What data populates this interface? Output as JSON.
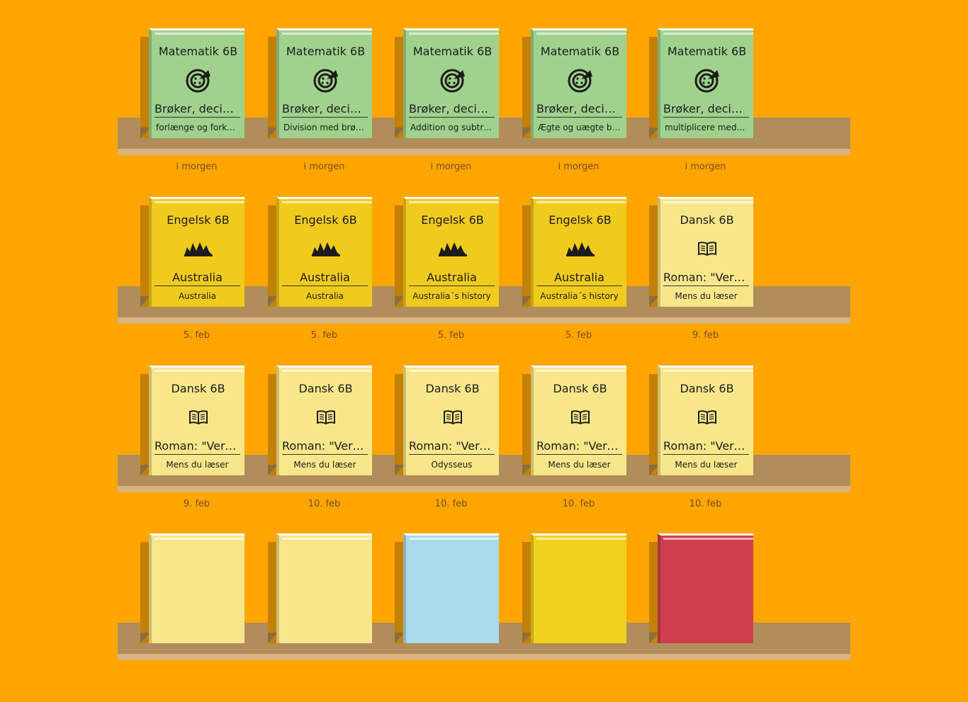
{
  "rows": [
    {
      "books": [
        {
          "color": "green",
          "subject": "Matematik 6B",
          "icon": "pie-chart-icon",
          "title": "Brøker, decimaltal",
          "lesson": "forlænge og forkorte",
          "date": "i morgen"
        },
        {
          "color": "green",
          "subject": "Matematik 6B",
          "icon": "pie-chart-icon",
          "title": "Brøker, decimaltal",
          "lesson": "Division med brøker",
          "date": "i morgen"
        },
        {
          "color": "green",
          "subject": "Matematik 6B",
          "icon": "pie-chart-icon",
          "title": "Brøker, decimaltal",
          "lesson": "Addition og subtraktion",
          "date": "i morgen"
        },
        {
          "color": "green",
          "subject": "Matematik 6B",
          "icon": "pie-chart-icon",
          "title": "Brøker, decimaltal",
          "lesson": "Ægte og uægte brøk",
          "date": "i morgen"
        },
        {
          "color": "green",
          "subject": "Matematik 6B",
          "icon": "pie-chart-icon",
          "title": "Brøker, decimaltal",
          "lesson": "multiplicere med brøker",
          "date": "i morgen"
        }
      ]
    },
    {
      "books": [
        {
          "color": "yellow",
          "subject": "Engelsk 6B",
          "icon": "opera-house-icon",
          "title": "Australia",
          "lesson": "Australia",
          "date": "5. feb"
        },
        {
          "color": "yellow",
          "subject": "Engelsk 6B",
          "icon": "opera-house-icon",
          "title": "Australia",
          "lesson": "Australia",
          "date": "5. feb"
        },
        {
          "color": "yellow",
          "subject": "Engelsk 6B",
          "icon": "opera-house-icon",
          "title": "Australia",
          "lesson": "Australia´s history",
          "date": "5. feb"
        },
        {
          "color": "yellow",
          "subject": "Engelsk 6B",
          "icon": "opera-house-icon",
          "title": "Australia",
          "lesson": "Australia´s history",
          "date": "5. feb"
        },
        {
          "color": "paleyellow",
          "subject": "Dansk 6B",
          "icon": "open-book-icon",
          "title": "Roman: \"Verdens\"",
          "lesson": "Mens du læser",
          "date": "9. feb"
        }
      ]
    },
    {
      "books": [
        {
          "color": "paleyellow",
          "subject": "Dansk 6B",
          "icon": "open-book-icon",
          "title": "Roman: \"Verdens\"",
          "lesson": "Mens du læser",
          "date": "9. feb"
        },
        {
          "color": "paleyellow",
          "subject": "Dansk 6B",
          "icon": "open-book-icon",
          "title": "Roman: \"Verdens\"",
          "lesson": "Mens du læser",
          "date": "10. feb"
        },
        {
          "color": "paleyellow",
          "subject": "Dansk 6B",
          "icon": "open-book-icon",
          "title": "Roman: \"Verdens\"",
          "lesson": "Odysseus",
          "date": "10. feb"
        },
        {
          "color": "paleyellow",
          "subject": "Dansk 6B",
          "icon": "open-book-icon",
          "title": "Roman: \"Verdens\"",
          "lesson": "Mens du læser",
          "date": "10. feb"
        },
        {
          "color": "paleyellow",
          "subject": "Dansk 6B",
          "icon": "open-book-icon",
          "title": "Roman: \"Verdens\"",
          "lesson": "Mens du læser",
          "date": "10. feb"
        }
      ]
    },
    {
      "books": [
        {
          "color": "paleyellow",
          "subject": "",
          "icon": "",
          "title": "",
          "lesson": "",
          "date": ""
        },
        {
          "color": "paleyellow",
          "subject": "",
          "icon": "",
          "title": "",
          "lesson": "",
          "date": ""
        },
        {
          "color": "blue",
          "subject": "",
          "icon": "",
          "title": "",
          "lesson": "",
          "date": ""
        },
        {
          "color": "gold",
          "subject": "",
          "icon": "",
          "title": "",
          "lesson": "",
          "date": ""
        },
        {
          "color": "red",
          "subject": "",
          "icon": "",
          "title": "",
          "lesson": "",
          "date": ""
        }
      ]
    }
  ]
}
